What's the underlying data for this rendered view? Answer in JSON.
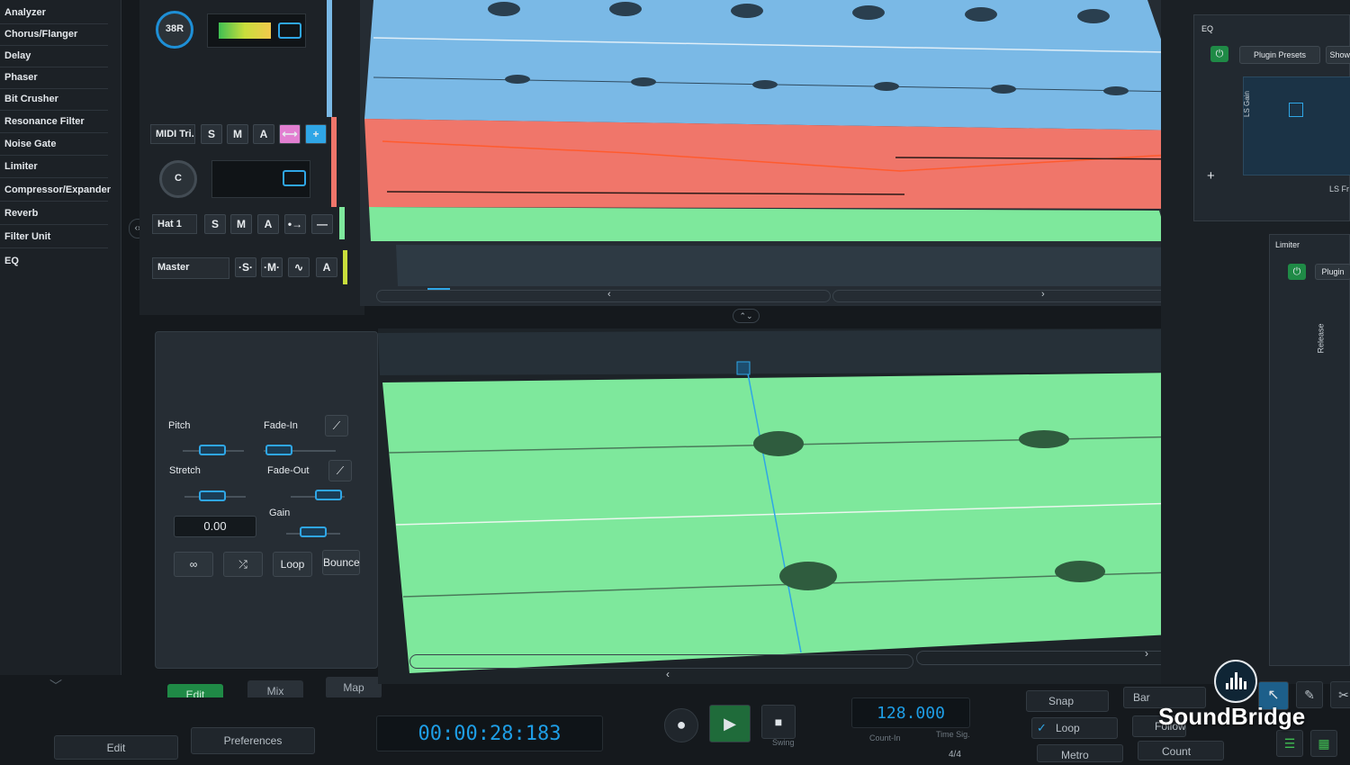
{
  "plugins": [
    "Analyzer",
    "Chorus/Flanger",
    "Delay",
    "Phaser",
    "Bit Crusher",
    "Resonance Filter",
    "Noise Gate",
    "Limiter",
    "Compressor/Expander",
    "Reverb",
    "Filter Unit",
    "EQ"
  ],
  "mixer": {
    "knob1_value": "38R",
    "knob2_value": "C",
    "channels": [
      {
        "name": "MIDI Tri...",
        "solo": "S",
        "mute": "M",
        "arm": "A"
      },
      {
        "name": "Hat 1",
        "solo": "S",
        "mute": "M",
        "arm": "A"
      },
      {
        "name": "Master",
        "solo": "·S·",
        "mute": "·M·",
        "arm": "A"
      }
    ]
  },
  "sample_editor": {
    "pitch_label": "Pitch",
    "fadein_label": "Fade-In",
    "stretch_label": "Stretch",
    "fadeout_label": "Fade-Out",
    "gain_label": "Gain",
    "value": "0.00",
    "loop_label": "Loop",
    "bounce_label": "Bounce"
  },
  "tabs": {
    "edit": "Edit",
    "mix": "Mix",
    "map": "Map"
  },
  "right": {
    "eq_label": "EQ",
    "plugin_presets": "Plugin Presets",
    "show_label": "Show P",
    "limiter_label": "Limiter",
    "plugin_label": "Plugin",
    "release_label": "Release",
    "ls_gain": "LS Gain",
    "ls_freq": "LS Fr"
  },
  "transport": {
    "time": "00:00:28:183",
    "tempo": "128.000",
    "count_in": "Count-In",
    "time_sig": "Time Sig.",
    "swing": "Swing",
    "snap": "Snap",
    "bar": "Bar",
    "loop": "Loop",
    "follow": "Follow",
    "metro": "Metro",
    "count": "Count",
    "time_sig_value": "4/4"
  },
  "bottom_tabs": {
    "edit": "Edit",
    "preferences": "Preferences"
  },
  "brand": "SoundBridge",
  "colors": {
    "accent": "#2fa6e6",
    "green_clip": "#7ee89c",
    "red_clip": "#f0766a",
    "blue_clip": "#7ab9e6"
  }
}
